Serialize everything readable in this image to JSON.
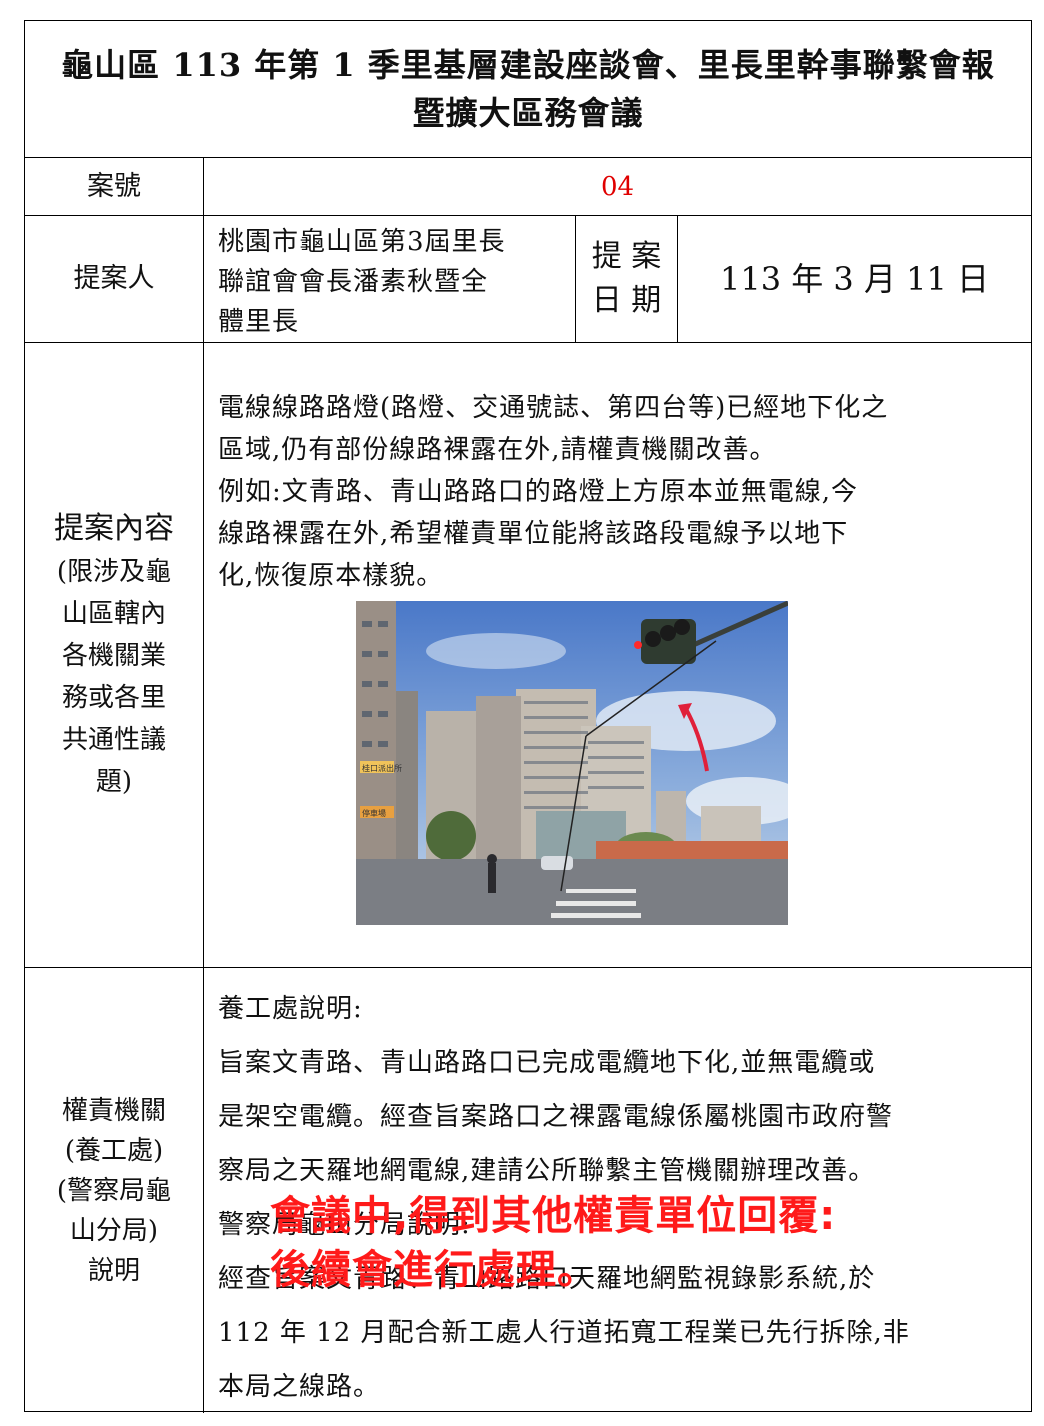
{
  "title": {
    "line1": "龜山區 113 年第 1 季里基層建設座談會、里長里幹事聯繫會報",
    "line2": "暨擴大區務會議"
  },
  "case_no": {
    "label": "案號",
    "value": "04"
  },
  "proposer": {
    "label": "提案人",
    "lines": [
      "桃園市龜山區第3屆里長",
      "聯誼會會長潘素秋暨全",
      "體里長"
    ],
    "date_label_line1": "提 案",
    "date_label_line2": "日 期",
    "date_value": "113 年 3 月 11 日"
  },
  "content": {
    "label_main": "提案內容",
    "label_sub": [
      "(限涉及龜",
      "山區轄內",
      "各機關業",
      "務或各里",
      "共通性議",
      "題)"
    ],
    "para1_lines": [
      "電線線路路燈(路燈、交通號誌、第四台等)已經地下化之",
      "區域,仍有部份線路裸露在外,請權責機關改善。"
    ],
    "para2_lines": [
      "例如:文青路、青山路路口的路燈上方原本並無電線,今",
      "線路裸露在外,希望權責單位能將該路段電線予以地下",
      "化,恢復原本樣貌。"
    ]
  },
  "authority": {
    "label_lines": [
      "權責機關",
      "(養工處)",
      "(警察局龜",
      "山分局)",
      "說明"
    ],
    "lines": [
      "養工處說明:",
      "旨案文青路、青山路路口已完成電纜地下化,並無電纜或",
      "是架空電纜。經查旨案路口之裸露電線係屬桃園市政府警",
      "察局之天羅地網電線,建請公所聯繫主管機關辦理改善。",
      "警察局龜山分局說明:",
      "經查旨案文青路、青山路路口天羅地網監視錄影系統,於",
      "112 年 12 月配合新工處人行道拓寬工程業已先行拆除,非",
      "本局之線路。"
    ],
    "overlay_lines": [
      "會議中,得到其他權責單位回覆:",
      "後續會進行處理。"
    ]
  },
  "photo": {
    "sign1": "桂口派出所",
    "sign2": "停車場"
  },
  "colors": {
    "red": "#e00000",
    "overlay": "#ff1a1a"
  }
}
